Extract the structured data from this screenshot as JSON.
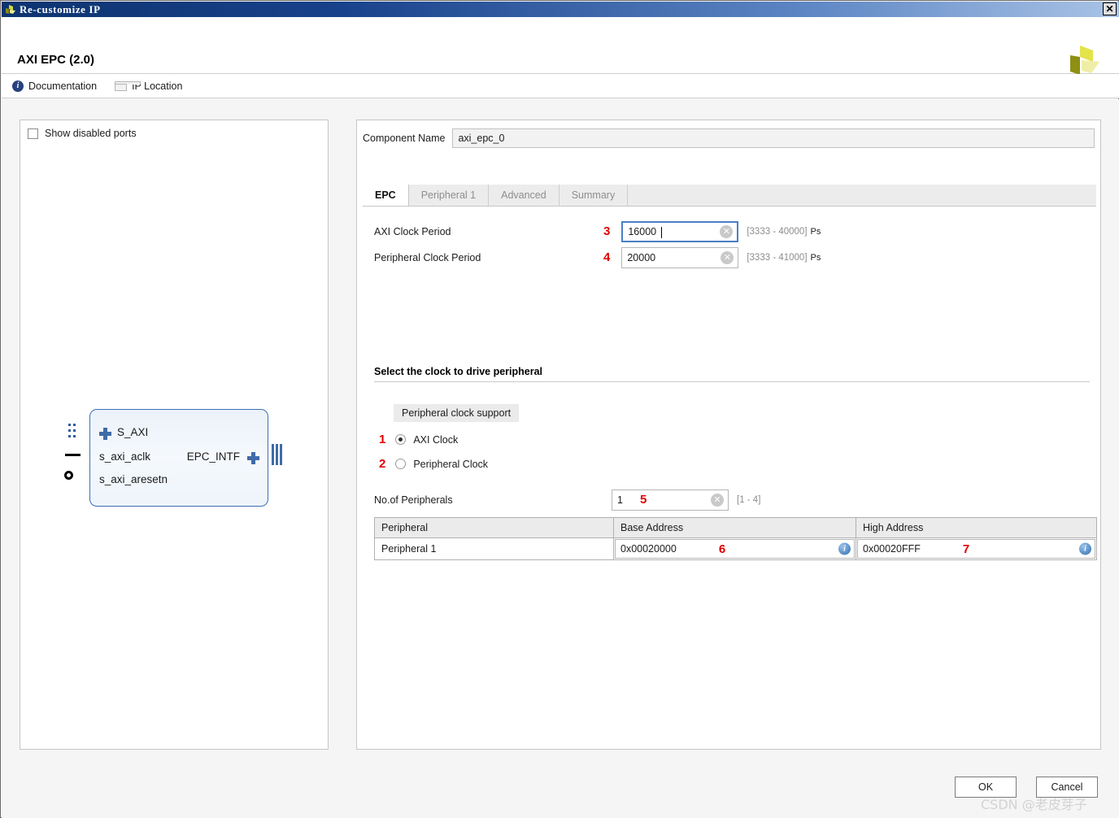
{
  "window": {
    "title": "Re-customize IP",
    "close_label": "✕",
    "app_icon": "xilinx-logo-icon"
  },
  "header": {
    "ip_title": "AXI EPC (2.0)",
    "logo_icon": "xilinx-logo"
  },
  "toolbar": {
    "items": [
      {
        "label": "Documentation",
        "icon": "info-icon"
      },
      {
        "label": "IP Location",
        "icon": "folder-icon"
      }
    ]
  },
  "left_panel": {
    "show_disabled_ports_label": "Show disabled ports",
    "show_disabled_ports_checked": false,
    "diagram": {
      "bus_ports_left": [
        "S_AXI"
      ],
      "ports_left": [
        "s_axi_aclk",
        "s_axi_aresetn"
      ],
      "bus_ports_right": [
        "EPC_INTF"
      ]
    }
  },
  "right_panel": {
    "component_name_label": "Component Name",
    "component_name_value": "axi_epc_0",
    "tabs": [
      {
        "label": "EPC",
        "active": true
      },
      {
        "label": "Peripheral 1",
        "active": false
      },
      {
        "label": "Advanced",
        "active": false
      },
      {
        "label": "Summary",
        "active": false
      }
    ],
    "fields": [
      {
        "label": "AXI Clock Period",
        "value": "16000",
        "range": "[3333 - 40000]",
        "unit": "Ps",
        "marker": "3",
        "focused": true
      },
      {
        "label": "Peripheral Clock Period",
        "value": "20000",
        "range": "[3333 - 41000]",
        "unit": "Ps",
        "marker": "4",
        "focused": false
      }
    ],
    "clock_section": {
      "title": "Select the clock to drive peripheral",
      "group_tab_label": "Peripheral clock support",
      "options": [
        {
          "label": "AXI Clock",
          "selected": true,
          "marker": "1"
        },
        {
          "label": "Peripheral Clock",
          "selected": false,
          "marker": "2"
        }
      ]
    },
    "peripheral_count": {
      "label": "No.of Peripherals",
      "value": "1",
      "range": "[1 - 4]",
      "marker": "5"
    },
    "table": {
      "columns": [
        "Peripheral",
        "Base Address",
        "High Address"
      ],
      "rows": [
        {
          "peripheral": "Peripheral 1",
          "base_address": "0x00020000",
          "base_marker": "6",
          "high_address": "0x00020FFF",
          "high_marker": "7",
          "info_icon": "info-icon"
        }
      ]
    }
  },
  "footer": {
    "ok_label": "OK",
    "cancel_label": "Cancel"
  },
  "watermark": {
    "text": "CSDN @老皮芽子"
  },
  "colors": {
    "titlebar_dark": "#0d3470",
    "titlebar_light": "#a9c3e6",
    "accent_blue": "#4a7ec7",
    "marker_red": "#e00000",
    "block_border": "#3d6fb4",
    "xilinx_yellow": "#c8c81e"
  }
}
